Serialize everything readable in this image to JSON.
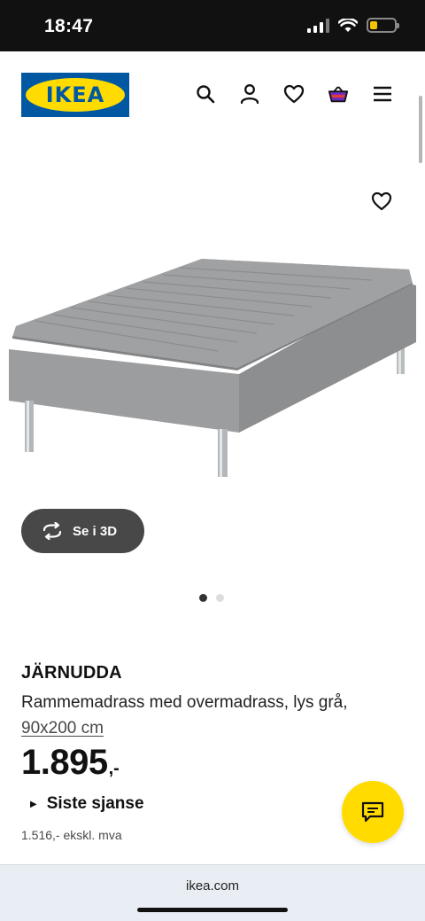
{
  "status_bar": {
    "time": "18:47",
    "icons": [
      "cellular-signal-icon",
      "wifi-icon",
      "battery-icon"
    ],
    "battery_level": 0.3,
    "battery_color": "#f5c400"
  },
  "header": {
    "logo_text": "IKEA",
    "brand_blue": "#0058a3",
    "brand_yellow": "#ffdb00",
    "nav_icons": [
      "search-icon",
      "user-icon",
      "heart-icon",
      "basket-icon",
      "menu-icon"
    ]
  },
  "gallery": {
    "view_3d_label": "Se i 3D",
    "current_image": 1,
    "image_count": 2
  },
  "product": {
    "name": "JÄRNUDDA",
    "description": "Rammemadrass med overmadrass, lys grå,",
    "size": "90x200 cm",
    "price": "1.895",
    "price_suffix": ",-",
    "tag": "Siste sjanse",
    "price_excl_vat": "1.516,- ekskl. mva"
  },
  "browser": {
    "url": "ikea.com"
  }
}
